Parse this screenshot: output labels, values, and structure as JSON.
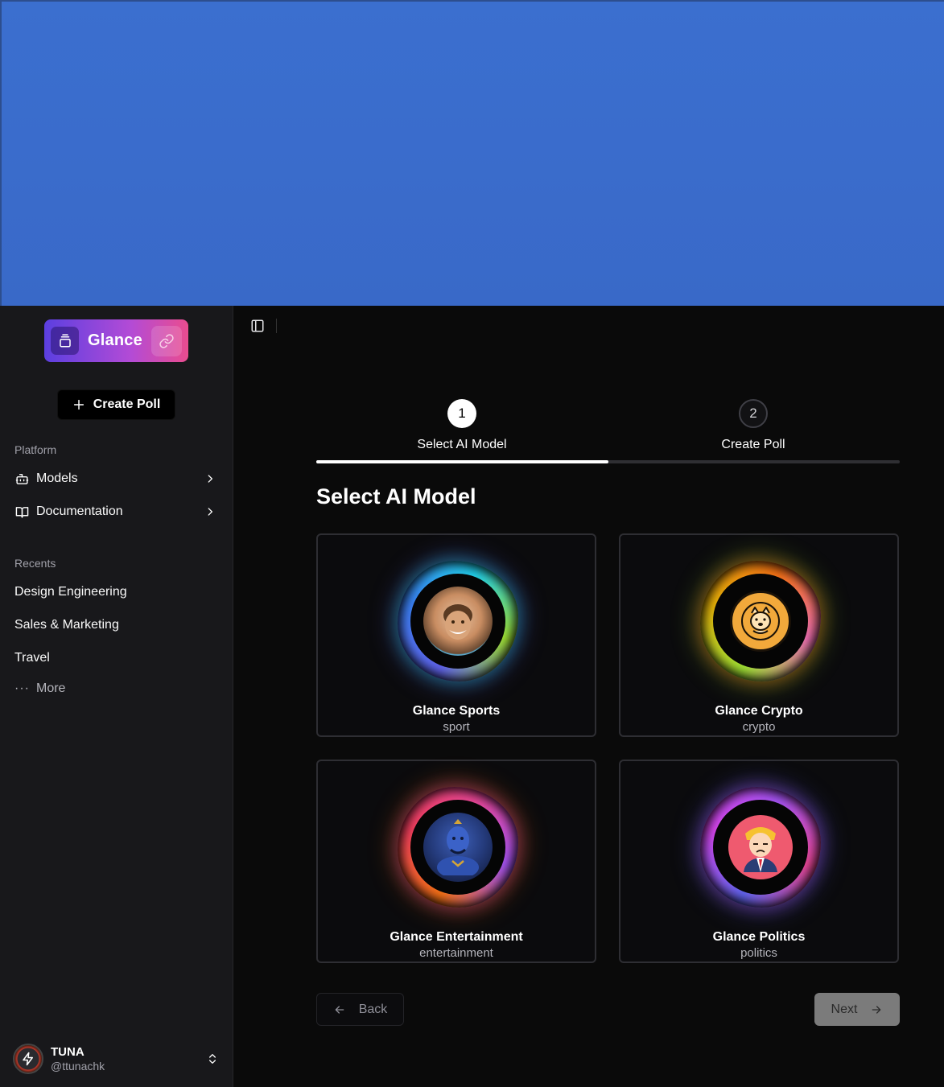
{
  "brand": {
    "name": "Glance"
  },
  "sidebar": {
    "create_label": "Create Poll",
    "platform_label": "Platform",
    "platform_items": [
      {
        "label": "Models",
        "icon": "bot-icon"
      },
      {
        "label": "Documentation",
        "icon": "book-icon"
      }
    ],
    "recents_label": "Recents",
    "recents": [
      "Design Engineering",
      "Sales & Marketing",
      "Travel"
    ],
    "more_label": "More"
  },
  "user": {
    "name": "TUNA",
    "handle": "@ttunachk"
  },
  "stepper": {
    "progress": 0.5,
    "steps": [
      {
        "number": "1",
        "label": "Select AI Model",
        "state": "active"
      },
      {
        "number": "2",
        "label": "Create Poll",
        "state": "inactive"
      }
    ]
  },
  "main": {
    "title": "Select AI Model",
    "models": [
      {
        "name": "Glance Sports",
        "category": "sport",
        "avatar_icon": "smiling-man-avatar",
        "glow": [
          "#22d3ee",
          "#a3e635",
          "#6366f1",
          "#3b82f6"
        ]
      },
      {
        "name": "Glance Crypto",
        "category": "crypto",
        "avatar_icon": "doge-coin-icon",
        "glow": [
          "#f97316",
          "#f472b6",
          "#a3e635",
          "#eab308"
        ]
      },
      {
        "name": "Glance Entertainment",
        "category": "entertainment",
        "avatar_icon": "genie-avatar",
        "glow": [
          "#ec4899",
          "#a855f7",
          "#f97316",
          "#f43f5e"
        ]
      },
      {
        "name": "Glance Politics",
        "category": "politics",
        "avatar_icon": "politician-avatar",
        "glow": [
          "#a855f7",
          "#ec4899",
          "#6366f1",
          "#d946ef"
        ]
      }
    ],
    "back_label": "Back",
    "next_label": "Next"
  }
}
